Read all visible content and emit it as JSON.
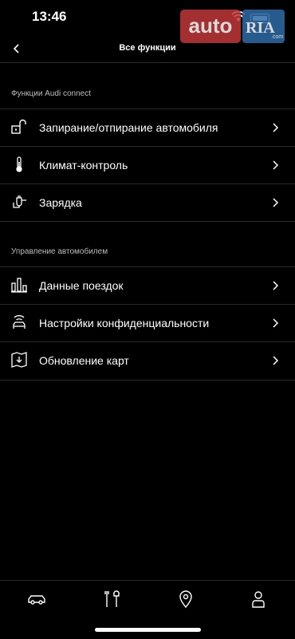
{
  "status_bar": {
    "time": "13:46"
  },
  "watermark": {
    "left": "auto",
    "right": "RIA",
    "suffix": ".com"
  },
  "nav": {
    "title": "Все функции"
  },
  "sections": [
    {
      "title": "Функции Audi connect",
      "items": [
        {
          "label": "Запирание/отпирание автомобиля",
          "icon": "unlock-icon"
        },
        {
          "label": "Климат-контроль",
          "icon": "thermometer-icon"
        },
        {
          "label": "Зарядка",
          "icon": "charging-plug-icon"
        }
      ]
    },
    {
      "title": "Управление автомобилем",
      "items": [
        {
          "label": "Данные поездок",
          "icon": "bar-chart-icon"
        },
        {
          "label": "Настройки конфиденциальности",
          "icon": "car-signal-icon"
        },
        {
          "label": "Обновление карт",
          "icon": "map-download-icon"
        }
      ]
    }
  ],
  "tabbar": [
    "car-icon",
    "tools-icon",
    "location-pin-icon",
    "profile-icon"
  ]
}
